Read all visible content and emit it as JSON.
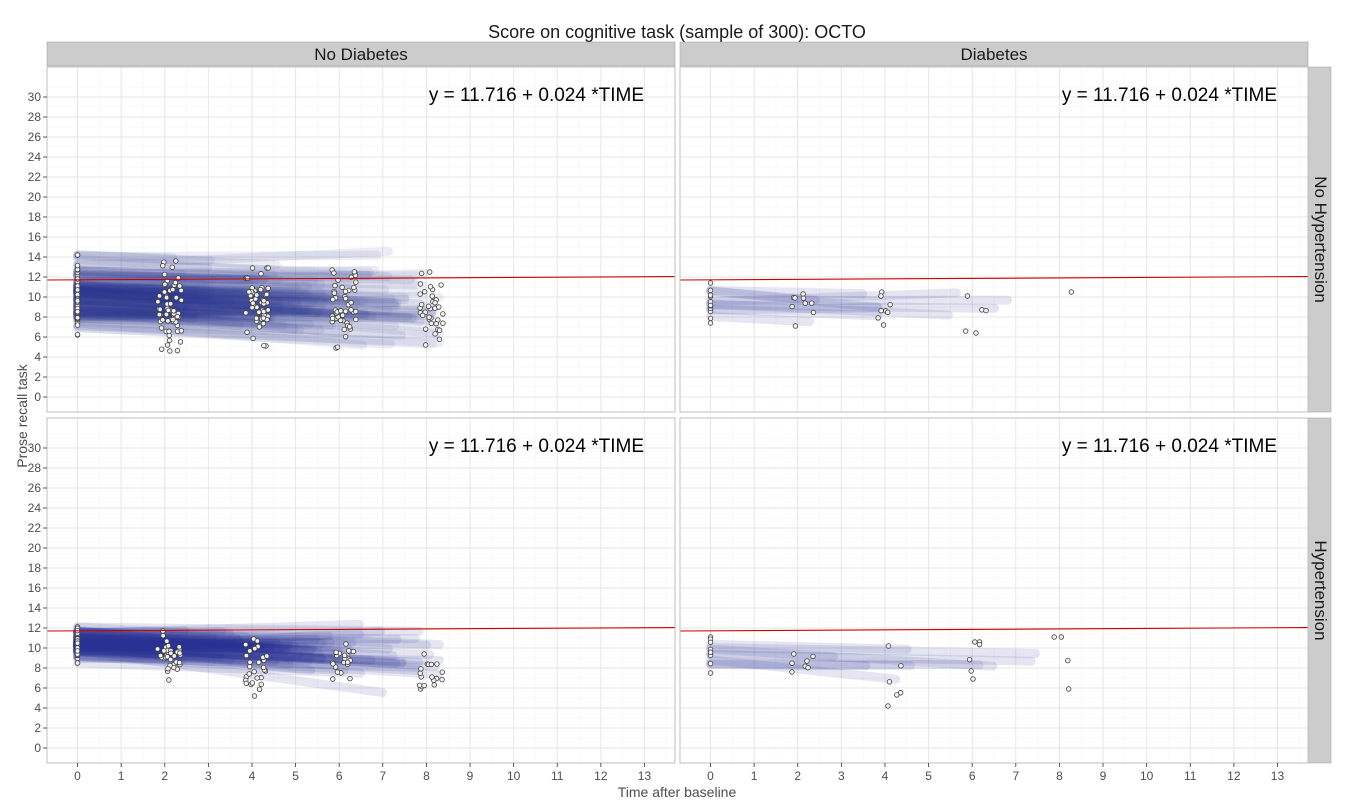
{
  "chart_data": {
    "type": "line",
    "title": "Score on cognitive task (sample of 300): OCTO",
    "xlabel": "Time after baseline",
    "ylabel": "Prose recall task",
    "xlim": [
      -0.7,
      13.7
    ],
    "ylim": [
      -1.5,
      33
    ],
    "x_ticks": [
      0,
      1,
      2,
      3,
      4,
      5,
      6,
      7,
      8,
      9,
      10,
      11,
      12,
      13
    ],
    "y_ticks": [
      0,
      2,
      4,
      6,
      8,
      10,
      12,
      14,
      16,
      18,
      20,
      22,
      24,
      26,
      28,
      30
    ],
    "grid": true,
    "col_facets": [
      "No Diabetes",
      "Diabetes"
    ],
    "row_facets": [
      "No Hypertension",
      "Hypertension"
    ],
    "colors": {
      "trajectory": "#283593",
      "fit_line": "#cc0000",
      "point_fill": "#f2f2f2",
      "point_stroke": "#404040",
      "strip_fill": "#cccccc",
      "panel_border": "#bfbfbf",
      "grid_major": "#e6e6e6",
      "grid_minor": "#f2f2f2"
    },
    "panels": [
      {
        "id": "nodiab-nohtn",
        "col": 0,
        "row": 0,
        "equation": "y =  11.716  +  0.024 *TIME",
        "fit_line": {
          "intercept": 11.716,
          "slope": 0.024,
          "x_range": [
            -0.7,
            13.7
          ]
        },
        "trajectory_count": 150,
        "trajectory_opacity": 0.09,
        "waves": [
          {
            "x": 0,
            "n": 80,
            "y_min": 6.2,
            "y_max": 14.2
          },
          {
            "x": 2,
            "n": 60,
            "y_min": 4.6,
            "y_max": 13.6
          },
          {
            "x": 4,
            "n": 55,
            "y_min": 5.1,
            "y_max": 12.9
          },
          {
            "x": 6,
            "n": 50,
            "y_min": 4.9,
            "y_max": 12.7
          },
          {
            "x": 8,
            "n": 35,
            "y_min": 5.2,
            "y_max": 12.5
          }
        ]
      },
      {
        "id": "diab-nohtn",
        "col": 1,
        "row": 0,
        "equation": "y =  11.716  +  0.024 *TIME",
        "fit_line": {
          "intercept": 11.716,
          "slope": 0.024,
          "x_range": [
            -0.7,
            13.7
          ]
        },
        "trajectory_count": 10,
        "trajectory_opacity": 0.12,
        "waves": [
          {
            "x": 0,
            "n": 12,
            "y_min": 7.4,
            "y_max": 11.4
          },
          {
            "x": 2,
            "n": 9,
            "y_min": 7.1,
            "y_max": 10.3
          },
          {
            "x": 4,
            "n": 8,
            "y_min": 7.2,
            "y_max": 10.5
          },
          {
            "x": 6,
            "n": 5,
            "y_min": 6.4,
            "y_max": 10.1
          },
          {
            "x": 8,
            "n": 1,
            "y_min": 10.5,
            "y_max": 10.5
          }
        ]
      },
      {
        "id": "nodiab-htn",
        "col": 0,
        "row": 1,
        "equation": "y =  11.716  +  0.024 *TIME",
        "fit_line": {
          "intercept": 11.716,
          "slope": 0.024,
          "x_range": [
            -0.7,
            13.7
          ]
        },
        "trajectory_count": 90,
        "trajectory_opacity": 0.12,
        "waves": [
          {
            "x": 0,
            "n": 40,
            "y_min": 8.5,
            "y_max": 12.1
          },
          {
            "x": 2,
            "n": 35,
            "y_min": 6.8,
            "y_max": 11.7
          },
          {
            "x": 4,
            "n": 28,
            "y_min": 5.2,
            "y_max": 10.9
          },
          {
            "x": 6,
            "n": 25,
            "y_min": 6.9,
            "y_max": 10.4
          },
          {
            "x": 8,
            "n": 18,
            "y_min": 5.9,
            "y_max": 9.4
          }
        ]
      },
      {
        "id": "diab-htn",
        "col": 1,
        "row": 1,
        "equation": "y =  11.716  +  0.024 *TIME",
        "fit_line": {
          "intercept": 11.716,
          "slope": 0.024,
          "x_range": [
            -0.7,
            13.7
          ]
        },
        "trajectory_count": 9,
        "trajectory_opacity": 0.12,
        "waves": [
          {
            "x": 0,
            "n": 9,
            "y_min": 7.5,
            "y_max": 11.1
          },
          {
            "x": 2,
            "n": 7,
            "y_min": 7.6,
            "y_max": 9.4
          },
          {
            "x": 4,
            "n": 6,
            "y_min": 4.2,
            "y_max": 10.2
          },
          {
            "x": 6,
            "n": 6,
            "y_min": 6.9,
            "y_max": 10.6
          },
          {
            "x": 8,
            "n": 4,
            "y_min": 5.9,
            "y_max": 11.1
          }
        ]
      }
    ]
  }
}
